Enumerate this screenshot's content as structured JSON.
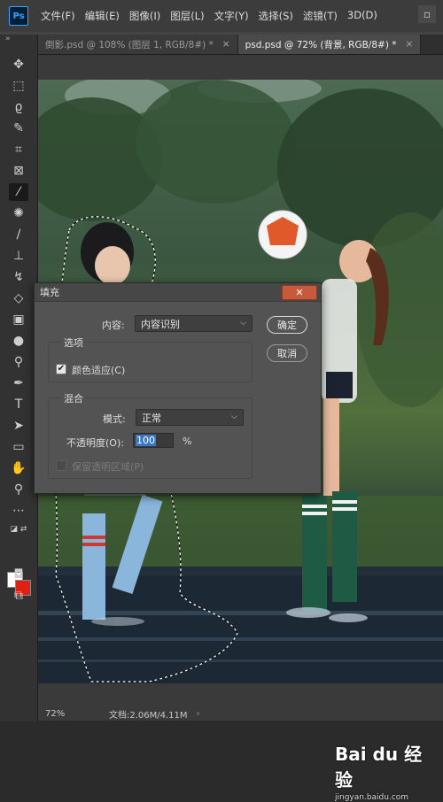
{
  "app": {
    "logo": "Ps"
  },
  "menu": [
    "文件(F)",
    "编辑(E)",
    "图像(I)",
    "图层(L)",
    "文字(Y)",
    "选择(S)",
    "滤镜(T)",
    "3D(D)"
  ],
  "window_button_icon": "restore-icon",
  "tabs": [
    {
      "label": "倒影.psd @ 108% (图层 1, RGB/8#) *",
      "close": "×",
      "active": false
    },
    {
      "label": "psd.psd @ 72% (背景, RGB/8#) *",
      "close": "×",
      "active": true
    }
  ],
  "tools": [
    "move-icon",
    "marquee-icon",
    "lasso-icon",
    "quick-select-icon",
    "crop-icon",
    "frame-icon",
    "eyedropper-icon",
    "healing-icon",
    "brush-icon",
    "stamp-icon",
    "history-brush-icon",
    "eraser-icon",
    "gradient-icon",
    "blur-icon",
    "dodge-icon",
    "pen-icon",
    "type-icon",
    "path-select-icon",
    "rectangle-icon",
    "hand-icon",
    "zoom-icon",
    "more-icon"
  ],
  "colors": {
    "foreground": "#ffffff",
    "background": "#e02010",
    "accent": "#3878c8",
    "dialog_close": "#c65a3b"
  },
  "dialog": {
    "title": "填充",
    "close": "✕",
    "content_label": "内容:",
    "content_value": "内容识别",
    "options_group": "选项",
    "color_adapt_label": "颜色适应(C)",
    "color_adapt_checked": true,
    "blend_group": "混合",
    "mode_label": "模式:",
    "mode_value": "正常",
    "opacity_label": "不透明度(O):",
    "opacity_value": "100",
    "opacity_unit": "%",
    "preserve_label": "保留透明区域(P)",
    "preserve_checked": false,
    "ok_label": "确定",
    "cancel_label": "取消"
  },
  "status": {
    "zoom": "72%",
    "doc": "文档:2.06M/4.11M",
    "arrow": "›"
  },
  "watermark": {
    "logo": "Bai du 经验",
    "url": "jingyan.baidu.com"
  }
}
